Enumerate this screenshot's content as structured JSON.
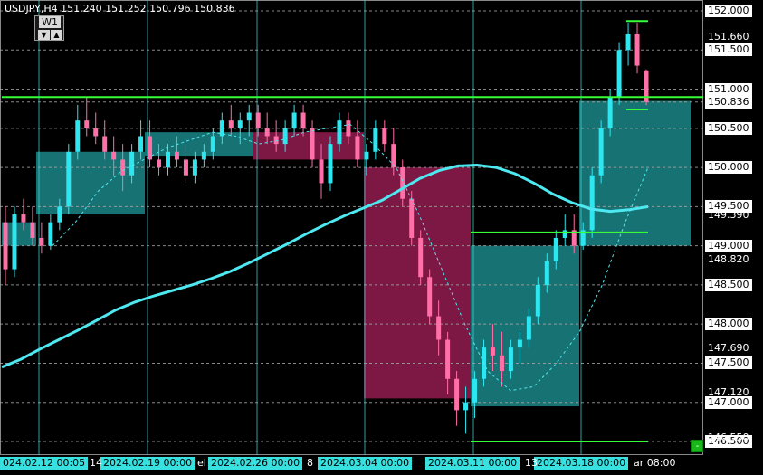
{
  "header": {
    "symbol_line": "USDJPY,H4  151.240 151.252 150.796 150.836",
    "timeframe": "W1",
    "arrow_down": "▼",
    "arrow_up": "▲"
  },
  "price_axis": {
    "boxed": [
      {
        "label": "152.000",
        "price": 152.0
      },
      {
        "label": "151.500",
        "price": 151.5
      },
      {
        "label": "151.000",
        "price": 151.0
      },
      {
        "label": "150.836",
        "price": 150.836
      },
      {
        "label": "150.500",
        "price": 150.5
      },
      {
        "label": "150.000",
        "price": 150.0
      },
      {
        "label": "149.500",
        "price": 149.5
      },
      {
        "label": "149.000",
        "price": 149.0
      },
      {
        "label": "148.500",
        "price": 148.5
      },
      {
        "label": "148.000",
        "price": 148.0
      },
      {
        "label": "147.500",
        "price": 147.5
      },
      {
        "label": "147.000",
        "price": 147.0
      },
      {
        "label": "146.500",
        "price": 146.5
      }
    ],
    "plain": [
      {
        "label": "151.660",
        "price": 151.66
      },
      {
        "label": "149.390",
        "price": 149.39
      },
      {
        "label": "148.820",
        "price": 148.82
      },
      {
        "label": "147.690",
        "price": 147.69
      },
      {
        "label": "147.120",
        "price": 147.12
      },
      {
        "label": "146.550",
        "price": 146.55
      }
    ]
  },
  "time_axis": {
    "boxed": [
      {
        "label": "024.02.12 00:05"
      },
      {
        "label": "2024.02.19 00:00"
      },
      {
        "label": "2024.02.26 00:00"
      },
      {
        "label": "2024.03.04 00:00"
      },
      {
        "label": "2024.03.11 00:00"
      },
      {
        "label": "2024.03.18 00:00"
      }
    ],
    "plain": [
      {
        "label": "14"
      },
      {
        "label": "el"
      },
      {
        "label": "8"
      },
      {
        "label": "13"
      },
      {
        "label": "ar 08:00"
      }
    ]
  },
  "corner_button": "-",
  "chart_data": {
    "type": "candlestick",
    "symbol": "USDJPY",
    "timeframe": "H4",
    "last": {
      "open": 151.24,
      "high": 151.252,
      "low": 150.796,
      "close": 150.836
    },
    "y_range": [
      146.45,
      152.12
    ],
    "weekly_boxes": [
      {
        "week": "2024.02.12",
        "open": 149.3,
        "close": 149.0,
        "color": "#1a7f7f"
      },
      {
        "week": "2024.02.12b",
        "open": 149.4,
        "close": 150.2,
        "color": "#1a7f7f"
      },
      {
        "week": "2024.02.19",
        "open": 150.45,
        "close": 150.15,
        "color": "#1a7f7f"
      },
      {
        "week": "2024.02.26",
        "open": 150.45,
        "close": 150.1,
        "color": "#8b1a4a"
      },
      {
        "week": "2024.03.04",
        "open": 150.0,
        "close": 147.05,
        "color": "#8b1a4a"
      },
      {
        "week": "2024.03.11",
        "open": 149.0,
        "close": 146.95,
        "color": "#1a7f7f"
      },
      {
        "week": "2024.03.18",
        "open": 149.0,
        "close": 150.85,
        "color": "#1a7f7f"
      }
    ],
    "horizontal_levels": [
      {
        "price": 150.9,
        "color": "#37ff37"
      },
      {
        "price": 149.17,
        "color": "#37ff37"
      },
      {
        "price": 146.5,
        "color": "#37ff37"
      }
    ],
    "candles": [
      [
        149.3,
        149.5,
        148.5,
        148.7
      ],
      [
        148.7,
        149.5,
        148.6,
        149.4
      ],
      [
        149.4,
        149.6,
        149.2,
        149.3
      ],
      [
        149.3,
        149.5,
        149.0,
        149.1
      ],
      [
        149.1,
        149.3,
        148.9,
        149.0
      ],
      [
        149.0,
        149.4,
        148.95,
        149.3
      ],
      [
        149.3,
        149.6,
        149.2,
        149.5
      ],
      [
        149.5,
        150.3,
        149.4,
        150.2
      ],
      [
        150.2,
        150.8,
        150.1,
        150.6
      ],
      [
        150.6,
        150.9,
        150.4,
        150.5
      ],
      [
        150.5,
        150.7,
        150.3,
        150.4
      ],
      [
        150.4,
        150.6,
        150.1,
        150.2
      ],
      [
        150.2,
        150.4,
        149.9,
        150.1
      ],
      [
        150.1,
        150.3,
        149.7,
        149.9
      ],
      [
        149.9,
        150.3,
        149.8,
        150.2
      ],
      [
        150.2,
        150.6,
        150.1,
        150.4
      ],
      [
        150.4,
        150.6,
        150.0,
        150.1
      ],
      [
        150.1,
        150.3,
        149.9,
        150.0
      ],
      [
        150.0,
        150.3,
        149.9,
        150.2
      ],
      [
        150.2,
        150.4,
        150.0,
        150.1
      ],
      [
        150.1,
        150.3,
        149.8,
        149.9
      ],
      [
        149.9,
        150.2,
        149.8,
        150.1
      ],
      [
        150.1,
        150.3,
        150.0,
        150.2
      ],
      [
        150.2,
        150.5,
        150.1,
        150.4
      ],
      [
        150.4,
        150.7,
        150.3,
        150.6
      ],
      [
        150.6,
        150.8,
        150.4,
        150.5
      ],
      [
        150.5,
        150.7,
        150.3,
        150.6
      ],
      [
        150.6,
        150.8,
        150.4,
        150.7
      ],
      [
        150.7,
        150.8,
        150.4,
        150.5
      ],
      [
        150.5,
        150.7,
        150.3,
        150.4
      ],
      [
        150.4,
        150.6,
        150.2,
        150.3
      ],
      [
        150.3,
        150.6,
        150.2,
        150.5
      ],
      [
        150.5,
        150.8,
        150.4,
        150.7
      ],
      [
        150.7,
        150.8,
        150.4,
        150.5
      ],
      [
        150.5,
        150.6,
        150.0,
        150.1
      ],
      [
        150.1,
        150.3,
        149.6,
        149.8
      ],
      [
        149.8,
        150.4,
        149.7,
        150.3
      ],
      [
        150.3,
        150.7,
        150.2,
        150.6
      ],
      [
        150.6,
        150.7,
        150.3,
        150.4
      ],
      [
        150.4,
        150.6,
        150.0,
        150.1
      ],
      [
        150.1,
        150.3,
        149.9,
        150.2
      ],
      [
        150.2,
        150.6,
        150.1,
        150.5
      ],
      [
        150.5,
        150.6,
        150.2,
        150.3
      ],
      [
        150.3,
        150.5,
        149.9,
        150.0
      ],
      [
        150.0,
        150.1,
        149.5,
        149.6
      ],
      [
        149.6,
        149.7,
        149.0,
        149.1
      ],
      [
        149.1,
        149.2,
        148.5,
        148.6
      ],
      [
        148.6,
        148.7,
        148.0,
        148.1
      ],
      [
        148.1,
        148.3,
        147.6,
        147.8
      ],
      [
        147.8,
        147.9,
        147.1,
        147.3
      ],
      [
        147.3,
        147.4,
        146.7,
        146.9
      ],
      [
        146.9,
        147.2,
        146.6,
        147.0
      ],
      [
        147.0,
        147.4,
        146.8,
        147.3
      ],
      [
        147.3,
        147.8,
        147.2,
        147.7
      ],
      [
        147.7,
        148.0,
        147.4,
        147.6
      ],
      [
        147.6,
        147.9,
        147.2,
        147.4
      ],
      [
        147.4,
        147.8,
        147.3,
        147.7
      ],
      [
        147.7,
        147.9,
        147.5,
        147.8
      ],
      [
        147.8,
        148.2,
        147.7,
        148.1
      ],
      [
        148.1,
        148.6,
        148.0,
        148.5
      ],
      [
        148.5,
        148.9,
        148.4,
        148.8
      ],
      [
        148.8,
        149.2,
        148.7,
        149.1
      ],
      [
        149.1,
        149.4,
        149.0,
        149.2
      ],
      [
        149.2,
        149.4,
        148.9,
        149.0
      ],
      [
        149.0,
        149.3,
        148.95,
        149.2
      ],
      [
        149.2,
        150.0,
        149.1,
        149.9
      ],
      [
        149.9,
        150.6,
        149.8,
        150.5
      ],
      [
        150.5,
        151.0,
        150.4,
        150.9
      ],
      [
        150.9,
        151.6,
        150.8,
        151.5
      ],
      [
        151.5,
        151.85,
        151.3,
        151.7
      ],
      [
        151.7,
        151.85,
        151.2,
        151.3
      ],
      [
        151.24,
        151.252,
        150.796,
        150.836
      ]
    ],
    "moving_averages": [
      {
        "name": "",
        "color": "#4ee8f0",
        "width": 3,
        "values": [
          147.45,
          147.55,
          147.68,
          147.8,
          147.92,
          148.05,
          148.18,
          148.28,
          148.36,
          148.43,
          148.5,
          148.58,
          148.67,
          148.78,
          148.9,
          149.02,
          149.15,
          149.27,
          149.38,
          149.48,
          149.58,
          149.72,
          149.86,
          149.96,
          150.02,
          150.03,
          150.0,
          149.92,
          149.8,
          149.66,
          149.55,
          149.47,
          149.44,
          149.46,
          149.5
        ]
      },
      {
        "name": "",
        "color": "#4ee8f0",
        "width": 1,
        "dash": true,
        "values": [
          149.0,
          149.3,
          149.7,
          149.95,
          150.1,
          150.25,
          150.35,
          150.45,
          150.4,
          150.3,
          150.35,
          150.45,
          150.5,
          150.55,
          150.3,
          150.0,
          149.4,
          148.7,
          148.0,
          147.4,
          147.15,
          147.2,
          147.5,
          147.9,
          148.5,
          149.3,
          150.0
        ]
      }
    ]
  }
}
